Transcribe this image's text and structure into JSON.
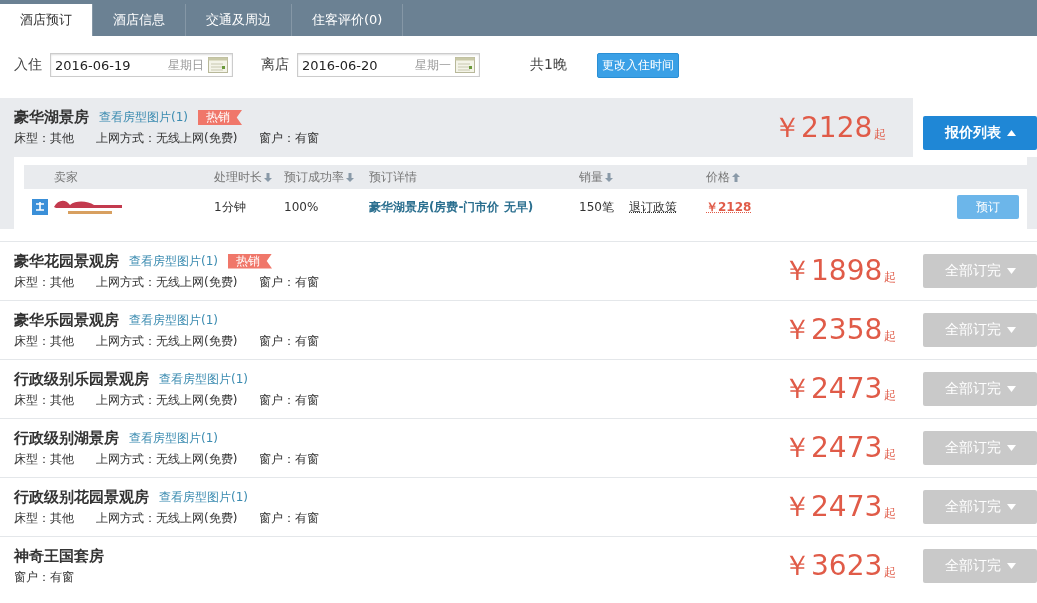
{
  "tabs": [
    {
      "label": "酒店预订",
      "selected": true
    },
    {
      "label": "酒店信息",
      "selected": false
    },
    {
      "label": "交通及周边",
      "selected": false
    },
    {
      "label": "住客评价(0)",
      "selected": false
    }
  ],
  "stay": {
    "checkin_label": "入住",
    "checkin_date": "2016-06-19",
    "checkin_weekday": "星期日",
    "checkout_label": "离店",
    "checkout_date": "2016-06-20",
    "checkout_weekday": "星期一",
    "nights": "共1晚",
    "change_button": "更改入住时间"
  },
  "rooms": [
    {
      "name": "豪华湖景房",
      "photos_link": "查看房型图片(1)",
      "badge": "热销",
      "details": [
        "床型：其他",
        "上网方式：无线上网(免费)",
        "窗户：有窗"
      ],
      "price": "￥2128",
      "price_suffix": "起",
      "button": "报价列表",
      "expanded": true,
      "offers": {
        "columns": [
          {
            "label": "卖家"
          },
          {
            "label": "处理时长",
            "sort_descending": true
          },
          {
            "label": "预订成功率",
            "sort_descending": true
          },
          {
            "label": "预订详情"
          },
          {
            "label": "销量",
            "sort_descending": true
          },
          {
            "label": "价格",
            "sort_descending": false
          }
        ],
        "rows": [
          {
            "time": "1分钟",
            "rate": "100%",
            "detail": "豪华湖景房(房费-门市价 无早)",
            "sales": "150笔",
            "policy": "退订政策",
            "price": "￥2128",
            "button": "预订"
          }
        ]
      }
    },
    {
      "name": "豪华花园景观房",
      "photos_link": "查看房型图片(1)",
      "badge": "热销",
      "details": [
        "床型：其他",
        "上网方式：无线上网(免费)",
        "窗户：有窗"
      ],
      "price": "￥1898",
      "price_suffix": "起",
      "button": "全部订完",
      "expanded": false
    },
    {
      "name": "豪华乐园景观房",
      "photos_link": "查看房型图片(1)",
      "details": [
        "床型：其他",
        "上网方式：无线上网(免费)",
        "窗户：有窗"
      ],
      "price": "￥2358",
      "price_suffix": "起",
      "button": "全部订完",
      "expanded": false
    },
    {
      "name": "行政级别乐园景观房",
      "photos_link": "查看房型图片(1)",
      "details": [
        "床型：其他",
        "上网方式：无线上网(免费)",
        "窗户：有窗"
      ],
      "price": "￥2473",
      "price_suffix": "起",
      "button": "全部订完",
      "expanded": false
    },
    {
      "name": "行政级别湖景房",
      "photos_link": "查看房型图片(1)",
      "details": [
        "床型：其他",
        "上网方式：无线上网(免费)",
        "窗户：有窗"
      ],
      "price": "￥2473",
      "price_suffix": "起",
      "button": "全部订完",
      "expanded": false
    },
    {
      "name": "行政级别花园景观房",
      "photos_link": "查看房型图片(1)",
      "details": [
        "床型：其他",
        "上网方式：无线上网(免费)",
        "窗户：有窗"
      ],
      "price": "￥2473",
      "price_suffix": "起",
      "button": "全部订完",
      "expanded": false
    },
    {
      "name": "神奇王国套房",
      "details": [
        "窗户：有窗"
      ],
      "price": "￥3623",
      "price_suffix": "起",
      "button": "全部订完",
      "expanded": false
    }
  ]
}
